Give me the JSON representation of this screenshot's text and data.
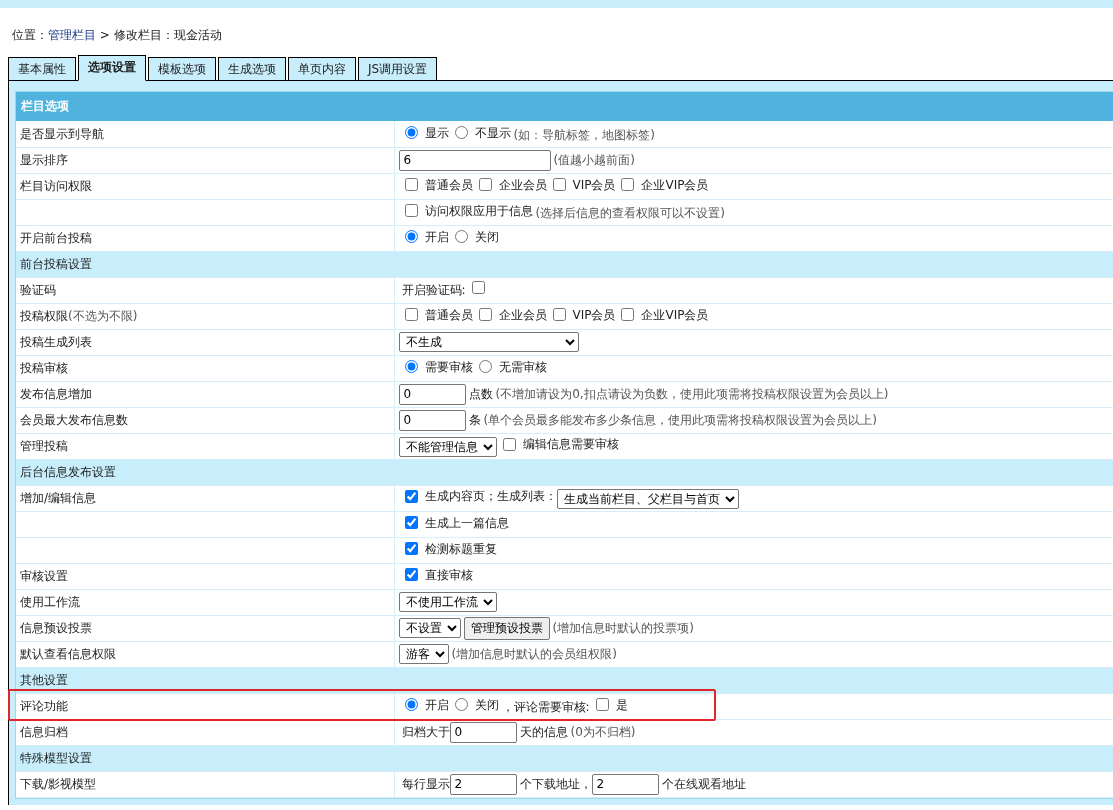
{
  "breadcrumb": {
    "prefix": "位置：",
    "link": "管理栏目",
    "rest": " > 修改栏目：现金活动"
  },
  "tabs": [
    {
      "label": "基本属性",
      "selected": false
    },
    {
      "label": "选项设置",
      "selected": true
    },
    {
      "label": "模板选项",
      "selected": false
    },
    {
      "label": "生成选项",
      "selected": false
    },
    {
      "label": "单页内容",
      "selected": false
    },
    {
      "label": "JS调用设置",
      "selected": false
    }
  ],
  "panel": {
    "title": "栏目选项"
  },
  "rows": [
    {
      "kind": "row",
      "label": "是否显示到导航",
      "controls": [
        {
          "kind": "radio",
          "label": "显示",
          "selected": true
        },
        {
          "kind": "radio",
          "label": "不显示",
          "selected": false
        },
        {
          "kind": "note",
          "text": "(如：导航标签，地图标签)"
        }
      ]
    },
    {
      "kind": "row",
      "label": "显示排序",
      "controls": [
        {
          "kind": "wide-input",
          "value": "6"
        },
        {
          "kind": "note",
          "text": "(值越小越前面)"
        }
      ]
    },
    {
      "kind": "row",
      "label": "栏目访问权限",
      "controls": [
        {
          "kind": "checkbox",
          "label": "普通会员",
          "checked": false
        },
        {
          "kind": "checkbox",
          "label": "企业会员",
          "checked": false
        },
        {
          "kind": "checkbox",
          "label": "VIP会员",
          "checked": false
        },
        {
          "kind": "checkbox",
          "label": "企业VIP会员",
          "checked": false
        }
      ]
    },
    {
      "kind": "row",
      "controls": [
        {
          "kind": "checkbox",
          "label": "访问权限应用于信息",
          "checked": false
        },
        {
          "kind": "note",
          "text": "(选择后信息的查看权限可以不设置)"
        }
      ]
    },
    {
      "kind": "row",
      "label": "开启前台投稿",
      "controls": [
        {
          "kind": "radio",
          "label": "开启",
          "selected": true
        },
        {
          "kind": "radio",
          "label": "关闭",
          "selected": false
        }
      ]
    },
    {
      "kind": "section",
      "label": "前台投稿设置"
    },
    {
      "kind": "row",
      "label": "验证码",
      "controls": [
        {
          "kind": "text",
          "text": "开启验证码:"
        },
        {
          "kind": "checkbox",
          "checked": false
        }
      ]
    },
    {
      "kind": "row",
      "label": "投稿权限",
      "label_note": "(不选为不限)",
      "controls": [
        {
          "kind": "checkbox",
          "label": "普通会员",
          "checked": false
        },
        {
          "kind": "checkbox",
          "label": "企业会员",
          "checked": false
        },
        {
          "kind": "checkbox",
          "label": "VIP会员",
          "checked": false
        },
        {
          "kind": "checkbox",
          "label": "企业VIP会员",
          "checked": false
        }
      ]
    },
    {
      "kind": "row",
      "label": "投稿生成列表",
      "controls": [
        {
          "kind": "wide-select",
          "value": "不生成"
        }
      ]
    },
    {
      "kind": "row",
      "label": "投稿审核",
      "controls": [
        {
          "kind": "radio",
          "label": "需要审核",
          "selected": true
        },
        {
          "kind": "radio",
          "label": "无需审核",
          "selected": false
        }
      ]
    },
    {
      "kind": "row",
      "label": "发布信息增加",
      "controls": [
        {
          "kind": "input",
          "value": "0"
        },
        {
          "kind": "text",
          "text": "点数"
        },
        {
          "kind": "note",
          "text": "(不增加请设为0,扣点请设为负数，使用此项需将投稿权限设置为会员以上)"
        }
      ]
    },
    {
      "kind": "row",
      "label": "会员最大发布信息数",
      "controls": [
        {
          "kind": "input",
          "value": "0"
        },
        {
          "kind": "text",
          "text": "条"
        },
        {
          "kind": "note",
          "text": "(单个会员最多能发布多少条信息，使用此项需将投稿权限设置为会员以上)"
        }
      ]
    },
    {
      "kind": "row",
      "label": "管理投稿",
      "controls": [
        {
          "kind": "select",
          "value": "不能管理信息"
        },
        {
          "kind": "checkbox",
          "label": "编辑信息需要审核",
          "checked": false
        }
      ]
    },
    {
      "kind": "section",
      "label": "后台信息发布设置"
    },
    {
      "kind": "row",
      "label": "增加/编辑信息",
      "controls": [
        {
          "kind": "checkbox",
          "label": "生成内容页；生成列表：",
          "checked": true
        },
        {
          "kind": "select",
          "value": "生成当前栏目、父栏目与首页"
        }
      ]
    },
    {
      "kind": "row",
      "controls": [
        {
          "kind": "checkbox",
          "label": "生成上一篇信息",
          "checked": true
        }
      ]
    },
    {
      "kind": "row",
      "controls": [
        {
          "kind": "checkbox",
          "label": "检测标题重复",
          "checked": true
        }
      ]
    },
    {
      "kind": "row",
      "label": "审核设置",
      "controls": [
        {
          "kind": "checkbox",
          "label": "直接审核",
          "checked": true
        }
      ]
    },
    {
      "kind": "row",
      "label": "使用工作流",
      "controls": [
        {
          "kind": "select",
          "value": "不使用工作流"
        }
      ]
    },
    {
      "kind": "row",
      "label": "信息预设投票",
      "controls": [
        {
          "kind": "select",
          "value": "不设置"
        },
        {
          "kind": "button",
          "label": "管理预设投票"
        },
        {
          "kind": "note",
          "text": "(增加信息时默认的投票项)"
        }
      ]
    },
    {
      "kind": "row",
      "label": "默认查看信息权限",
      "controls": [
        {
          "kind": "select",
          "value": "游客"
        },
        {
          "kind": "note",
          "text": "(增加信息时默认的会员组权限)"
        }
      ]
    },
    {
      "kind": "section",
      "label": "其他设置"
    },
    {
      "kind": "row",
      "label": "评论功能",
      "highlighted": true,
      "controls": [
        {
          "kind": "radio",
          "label": "开启",
          "selected": true
        },
        {
          "kind": "radio",
          "label": "关闭",
          "selected": false
        },
        {
          "kind": "text",
          "text": "，评论需要审核:"
        },
        {
          "kind": "checkbox",
          "label": "是",
          "checked": false
        }
      ]
    },
    {
      "kind": "row",
      "label": "信息归档",
      "controls": [
        {
          "kind": "text",
          "text": "归档大于"
        },
        {
          "kind": "input",
          "value": "0"
        },
        {
          "kind": "text",
          "text": "天的信息"
        },
        {
          "kind": "note",
          "text": "(0为不归档)"
        }
      ]
    },
    {
      "kind": "section",
      "label": "特殊模型设置"
    },
    {
      "kind": "row",
      "label": "下载/影视模型",
      "controls": [
        {
          "kind": "text",
          "text": "每行显示"
        },
        {
          "kind": "input",
          "value": "2"
        },
        {
          "kind": "text",
          "text": "个下载地址，"
        },
        {
          "kind": "input",
          "value": "2"
        },
        {
          "kind": "text",
          "text": "个在线观看地址"
        }
      ]
    }
  ]
}
